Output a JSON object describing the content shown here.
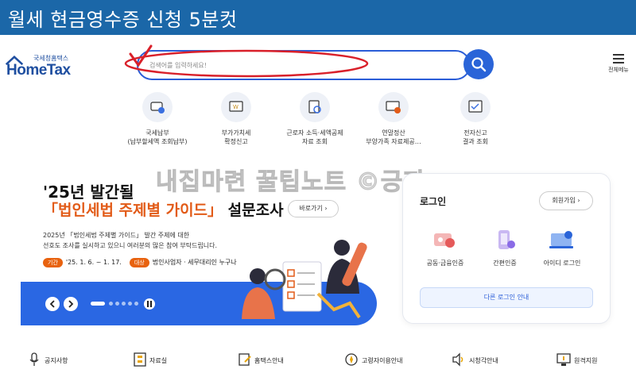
{
  "banner": {
    "title": "월세 현금영수증 신청 5분컷"
  },
  "logo": {
    "small": "국세청홈택스",
    "main": "HomeTax"
  },
  "search": {
    "placeholder": "검색어를 입력하세요!"
  },
  "menu": {
    "label": "전체메뉴"
  },
  "quick_menu": [
    {
      "line1": "국세납부",
      "line2": "(납부할세액 조회납부)",
      "icon": "tax-payment-icon"
    },
    {
      "line1": "부가가치세",
      "line2": "확정신고",
      "icon": "vat-report-icon"
    },
    {
      "line1": "근로자 소득·세액공제",
      "line2": "자료 조회",
      "icon": "worker-deduction-icon"
    },
    {
      "line1": "연말정산",
      "line2": "부양가족 자료제공…",
      "icon": "year-end-settlement-icon"
    },
    {
      "line1": "전자신고",
      "line2": "결과 조회",
      "icon": "e-filing-result-icon"
    }
  ],
  "survey": {
    "title_line1": "'25년 발간될",
    "title_highlight": "「법인세법 주제별 가이드」",
    "title_rest": " 설문조사",
    "shortcut": "바로가기",
    "desc_line1": "2025년 「법인세법 주제별 가이드」 발간 주제에 대한",
    "desc_line2": "선호도 조사를 실시하고 있으니 여러분의 많은 참여 부탁드립니다.",
    "period_tag": "기간",
    "period_value": "'25. 1. 6. ~ 1. 17.",
    "target_tag": "대상",
    "target_value": "법인사업자 · 세무대리인 누구나"
  },
  "login": {
    "title": "로그인",
    "signup": "회원가입",
    "options": [
      {
        "label": "공동·금융인증",
        "icon": "certificate-icon"
      },
      {
        "label": "간편인증",
        "icon": "simple-auth-icon"
      },
      {
        "label": "아이디 로그인",
        "icon": "id-login-icon"
      }
    ],
    "other": "다른 로그인 안내"
  },
  "watermark": "내집마련 꿀팁노트 ©긍자",
  "bottom_nav": [
    {
      "label": "공지사항",
      "icon": "microphone-icon"
    },
    {
      "label": "자료실",
      "icon": "archive-icon"
    },
    {
      "label": "홈택스안내",
      "icon": "guide-icon"
    },
    {
      "label": "고령자이용안내",
      "icon": "elderly-guide-icon"
    },
    {
      "label": "시청각안내",
      "icon": "audio-visual-icon"
    },
    {
      "label": "원격지원",
      "icon": "remote-support-icon"
    }
  ],
  "colors": {
    "banner": "#1b67a8",
    "accent": "#2a64d8",
    "highlight": "#e25b18",
    "annotation": "#d9202a"
  }
}
